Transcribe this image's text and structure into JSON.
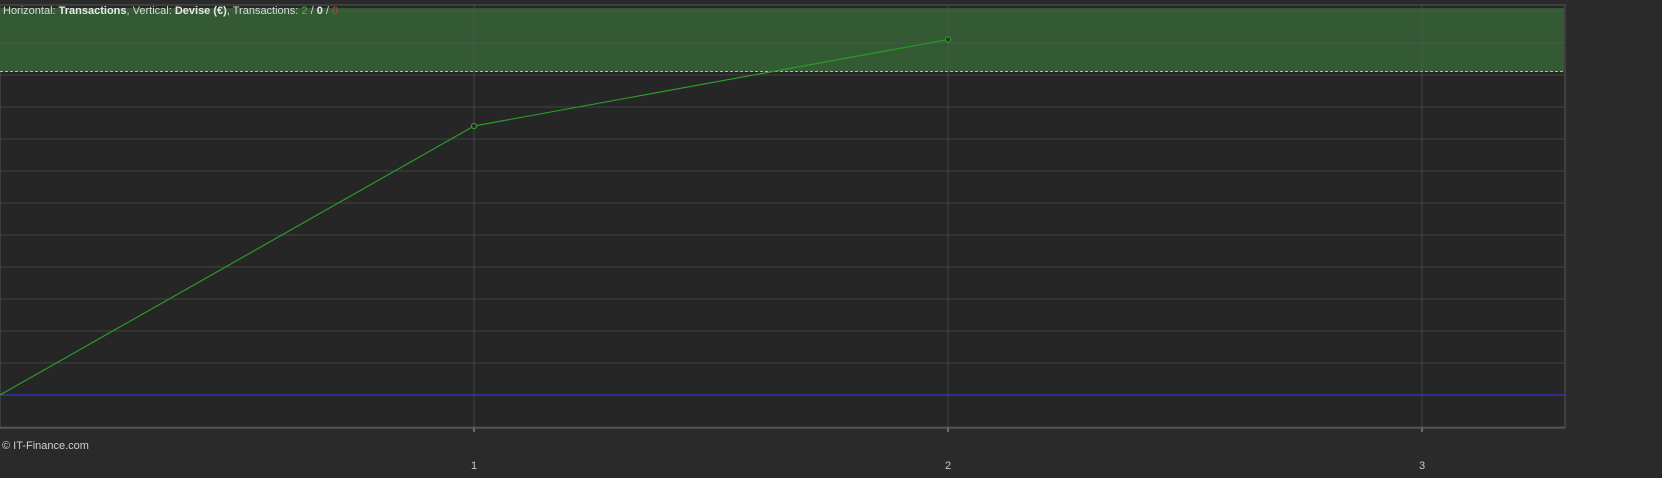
{
  "header": {
    "horizontal_label": "Horizontal:",
    "horizontal_value": "Transactions",
    "vertical_label": "Vertical:",
    "vertical_value": "Devise (€)",
    "transactions_label": "Transactions:",
    "win_count": "2",
    "even_count": "0",
    "loss_count": "0"
  },
  "copyright": "© IT-Finance.com",
  "colors": {
    "background": "#262626",
    "grid": "#3a3a3a",
    "line": "#2a9a2a",
    "zone_fill": "#335a33",
    "baseline": "#3333cc",
    "win": "#3fbf3f",
    "loss": "#d23a2a"
  },
  "chart_data": {
    "type": "line",
    "x_ticks": [
      1,
      2,
      3
    ],
    "xlim": [
      0,
      3.3
    ],
    "ylim": [
      0,
      100
    ],
    "grid": true,
    "series": [
      {
        "x": [
          0,
          1,
          2
        ],
        "y": [
          10,
          94,
          121
        ]
      }
    ],
    "baseline_y": 10,
    "highlight_zone_min_y": 111
  }
}
